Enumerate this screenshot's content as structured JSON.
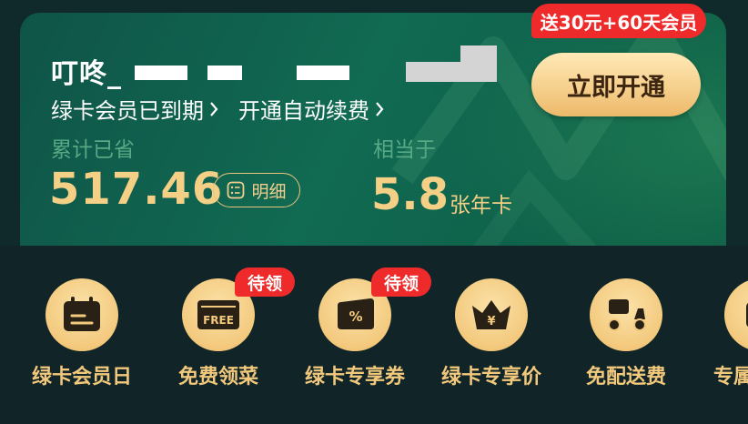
{
  "card": {
    "username": "叮咚_",
    "status": "绿卡会员已到期",
    "auto_renew": "开通自动续费",
    "saved_label": "累计已省",
    "saved_amount": "517.46",
    "detail_label": "明细",
    "equiv_label": "相当于",
    "equiv_value": "5.8",
    "equiv_unit": "张年卡",
    "open_button": "立即开通",
    "promo_badge": "送30元+60天会员"
  },
  "benefits": [
    {
      "label": "绿卡会员日",
      "icon": "calendar-icon",
      "tag": ""
    },
    {
      "label": "免费领菜",
      "icon": "free-ticket-icon",
      "tag": "待领"
    },
    {
      "label": "绿卡专享券",
      "icon": "coupon-icon",
      "tag": "待领"
    },
    {
      "label": "绿卡专享价",
      "icon": "crown-price-icon",
      "tag": ""
    },
    {
      "label": "免配送费",
      "icon": "delivery-scooter-icon",
      "tag": ""
    },
    {
      "label": "专属",
      "icon": "exclusive-icon",
      "tag": ""
    }
  ],
  "colors": {
    "card_green": "#116a52",
    "gold": "#f4cf86",
    "badge_red": "#ee2a2a",
    "panel_bg": "#112428"
  }
}
